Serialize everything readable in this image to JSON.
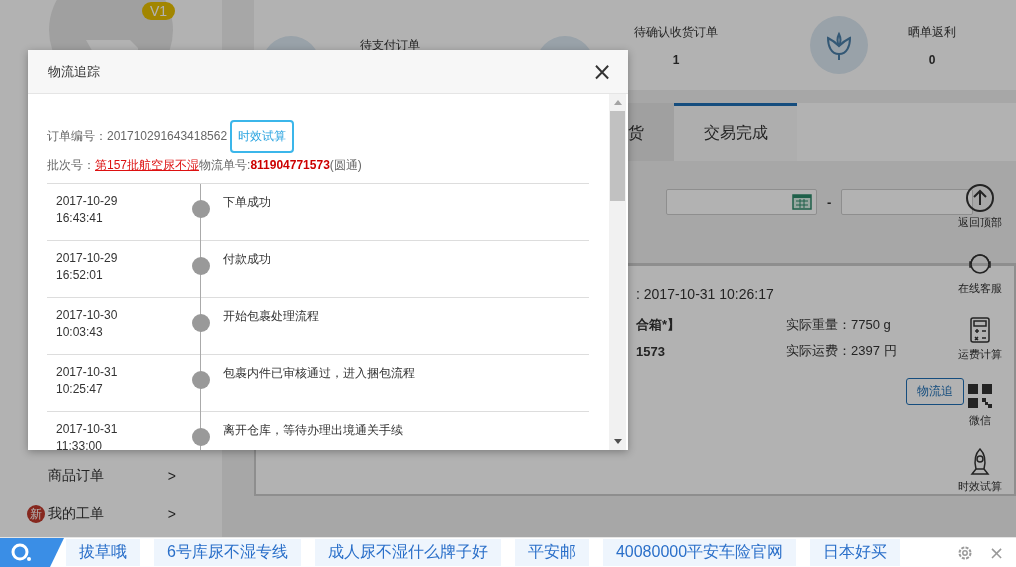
{
  "sidebar": {
    "badge": "V1",
    "items": [
      {
        "label": "商品订单",
        "arrow": ">"
      },
      {
        "label": "我的工单",
        "arrow": ">",
        "badge": "新"
      }
    ]
  },
  "stats": [
    {
      "label": "待支付订单"
    },
    {
      "label": "待确认收货订单",
      "value": "1"
    },
    {
      "label": "晒单返利",
      "value": "0"
    }
  ],
  "tabs": [
    {
      "label": "货",
      "selected": false
    },
    {
      "label": "交易完成",
      "selected": true
    }
  ],
  "date_range": {
    "separator": "-"
  },
  "order": {
    "time": ": 2017-10-31 10:26:17",
    "line1": "合箱*】",
    "weight": "实际重量：7750 g",
    "line2": "1573",
    "fee": "实际运费：2397 円",
    "button": "物流追"
  },
  "side_tools": [
    {
      "label": "返回顶部"
    },
    {
      "label": "在线客服"
    },
    {
      "label": "运费计算"
    },
    {
      "label": "微信"
    },
    {
      "label": "时效试算"
    }
  ],
  "dialog": {
    "title": "物流追踪",
    "close": "×",
    "order_label": "订单编号：",
    "order_no": "201710291643418562",
    "estimate_button": "时效试算",
    "batch_label": "批次号：",
    "batch": "第157批航空尿不湿",
    "tracking_label": "物流单号:",
    "tracking_no": "811904771573",
    "carrier": "(圆通)",
    "events": [
      {
        "date": "2017-10-29",
        "time": "16:43:41",
        "text": "下单成功"
      },
      {
        "date": "2017-10-29",
        "time": "16:52:01",
        "text": "付款成功"
      },
      {
        "date": "2017-10-30",
        "time": "10:03:43",
        "text": "开始包裹处理流程"
      },
      {
        "date": "2017-10-31",
        "time": "10:25:47",
        "text": "包裹内件已审核通过，进入捆包流程"
      },
      {
        "date": "2017-10-31",
        "time": "11:33:00",
        "text": "离开仓库，等待办理出境通关手续"
      }
    ]
  },
  "bottom_bar": {
    "links": [
      "拔草哦",
      "6号库尿不湿专线",
      "成人尿不湿什么牌子好",
      "平安邮",
      "40080000平安车险官网",
      "日本好买"
    ],
    "close": "×"
  }
}
